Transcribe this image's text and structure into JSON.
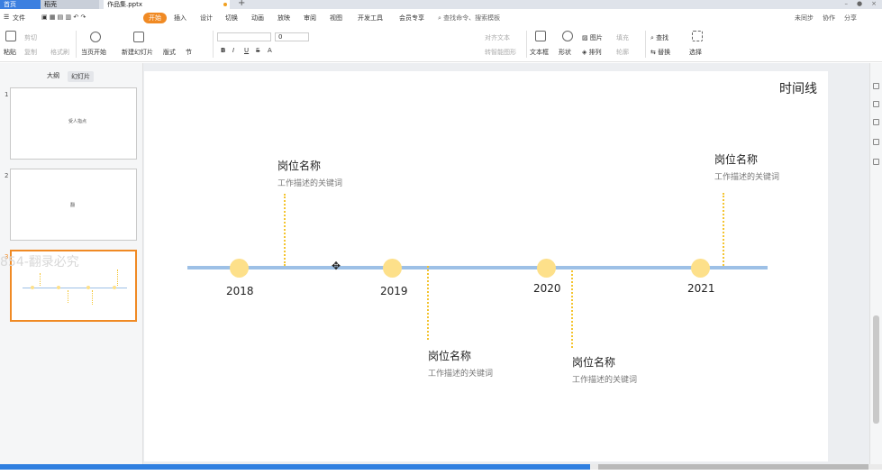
{
  "tabs": [
    {
      "label": "首页"
    },
    {
      "label": "稻壳"
    },
    {
      "label": "作品集.pptx"
    }
  ],
  "menu": {
    "file": "文件",
    "start": "开始",
    "items": [
      "插入",
      "设计",
      "切换",
      "动画",
      "放映",
      "审阅",
      "视图",
      "开发工具",
      "会员专享"
    ],
    "search": "查找命令、搜索模板",
    "right": [
      "未同步",
      "协作",
      "分享"
    ]
  },
  "ribbon": {
    "paste": "粘贴",
    "cut": "剪切",
    "copy": "复制",
    "format_painter": "格式刷",
    "from_current": "当页开始",
    "new_slide": "新建幻灯片",
    "layout": "版式",
    "section": "节",
    "font_size": "0",
    "align_text": "对齐文本",
    "convert_smartart": "转智能图形",
    "textbox": "文本框",
    "shape": "形状",
    "picture": "图片",
    "fill": "填充",
    "arrange": "排列",
    "outline": "轮廓",
    "find": "查找",
    "replace": "替换",
    "select": "选择"
  },
  "left_panel": {
    "tab_outline": "大纲",
    "tab_slides": "幻灯片",
    "slide_numbers": [
      "1",
      "2",
      "3"
    ],
    "thumb1_text": "受人指点",
    "thumb2_text": "翻",
    "watermark": "854-翻录必究"
  },
  "slide": {
    "title": "时间线",
    "years": [
      "2018",
      "2019",
      "2020",
      "2021"
    ],
    "entries": [
      {
        "title": "岗位名称",
        "desc": "工作描述的关键词"
      },
      {
        "title": "岗位名称",
        "desc": "工作描述的关键词"
      },
      {
        "title": "岗位名称",
        "desc": "工作描述的关键词"
      },
      {
        "title": "岗位名称",
        "desc": "工作描述的关键词"
      }
    ]
  },
  "colors": {
    "accent": "#f08a24",
    "tab_active": "#3b7fe0",
    "axis": "#9dc0e6",
    "dot": "#fde08a",
    "connector": "#f4c430"
  }
}
